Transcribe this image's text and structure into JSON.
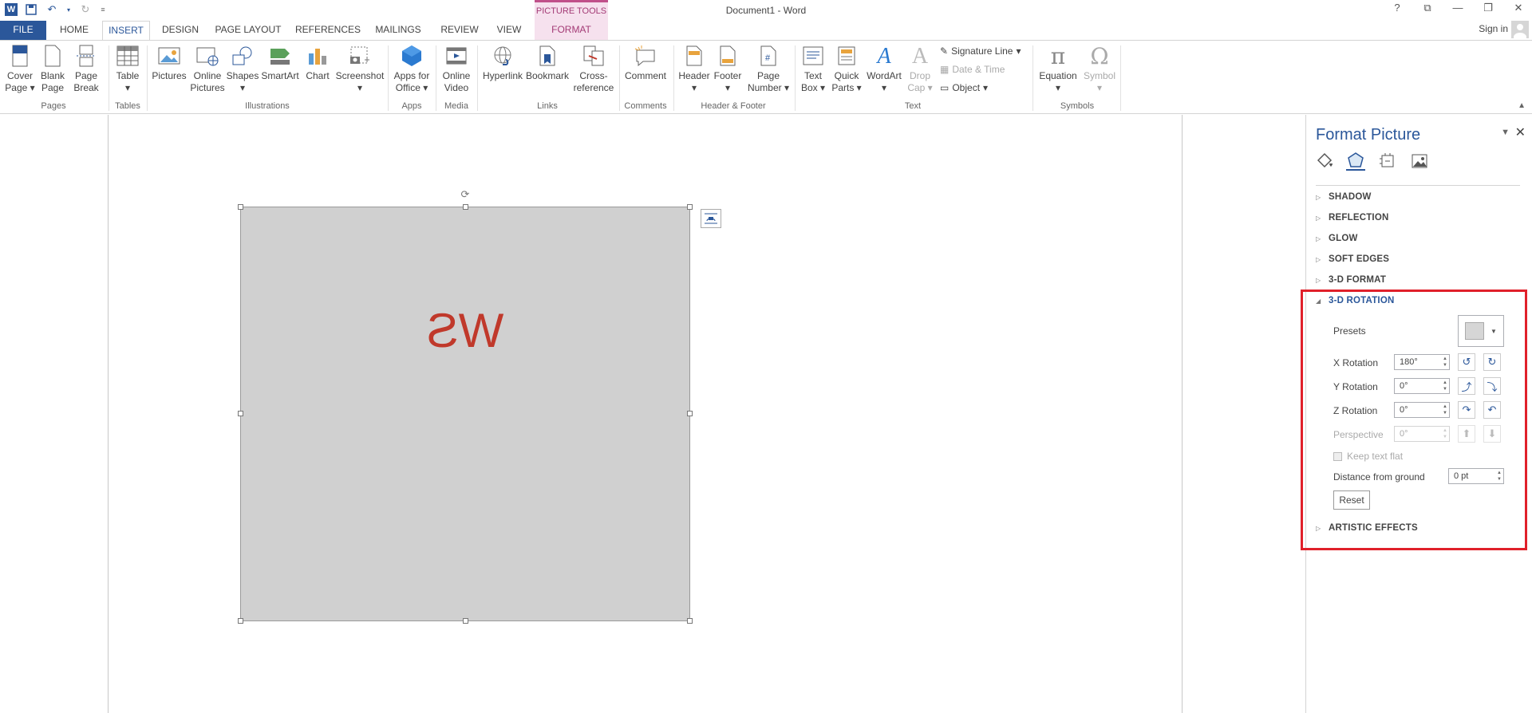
{
  "app": {
    "title": "Document1 - Word",
    "contextual_tab_group": "PICTURE TOOLS",
    "sign_in": "Sign in",
    "help": "?",
    "restore_label": "⧉",
    "minimize": "—",
    "maximize": "❐",
    "close": "✕"
  },
  "tabs": [
    "FILE",
    "HOME",
    "INSERT",
    "DESIGN",
    "PAGE LAYOUT",
    "REFERENCES",
    "MAILINGS",
    "REVIEW",
    "VIEW",
    "FORMAT"
  ],
  "active_tab": "INSERT",
  "ribbon": {
    "pages": {
      "label": "Pages",
      "cover_page": [
        "Cover",
        "Page"
      ],
      "blank_page": [
        "Blank",
        "Page"
      ],
      "page_break": [
        "Page",
        "Break"
      ]
    },
    "tables": {
      "label": "Tables",
      "table": "Table"
    },
    "illustrations": {
      "label": "Illustrations",
      "pictures": "Pictures",
      "online_pictures": [
        "Online",
        "Pictures"
      ],
      "shapes": "Shapes",
      "smartart": "SmartArt",
      "chart": "Chart",
      "screenshot": "Screenshot"
    },
    "apps": {
      "label": "Apps",
      "apps_for_office": [
        "Apps for",
        "Office"
      ]
    },
    "media": {
      "label": "Media",
      "online_video": [
        "Online",
        "Video"
      ]
    },
    "links": {
      "label": "Links",
      "hyperlink": "Hyperlink",
      "bookmark": "Bookmark",
      "cross_reference": [
        "Cross-",
        "reference"
      ]
    },
    "comments": {
      "label": "Comments",
      "comment": "Comment"
    },
    "header_footer": {
      "label": "Header & Footer",
      "header": "Header",
      "footer": "Footer",
      "page_number": [
        "Page",
        "Number"
      ]
    },
    "text": {
      "label": "Text",
      "text_box": [
        "Text",
        "Box"
      ],
      "quick_parts": [
        "Quick",
        "Parts"
      ],
      "wordart": "WordArt",
      "drop_cap": [
        "Drop",
        "Cap"
      ],
      "signature_line": "Signature Line",
      "date_time": "Date & Time",
      "object": "Object"
    },
    "symbols": {
      "label": "Symbols",
      "equation": "Equation",
      "symbol": "Symbol"
    }
  },
  "document": {
    "picture_text": "WS"
  },
  "pane": {
    "title": "Format Picture",
    "sections_collapsed_top": [
      "SHADOW",
      "REFLECTION",
      "GLOW",
      "SOFT EDGES",
      "3-D FORMAT"
    ],
    "expanded_section": "3-D ROTATION",
    "presets_label": "Presets",
    "x_rotation_label": "X Rotation",
    "x_rotation_value": "180°",
    "y_rotation_label": "Y Rotation",
    "y_rotation_value": "0°",
    "z_rotation_label": "Z Rotation",
    "z_rotation_value": "0°",
    "perspective_label": "Perspective",
    "perspective_value": "0°",
    "keep_text_flat": "Keep text flat",
    "distance_label": "Distance from ground",
    "distance_value": "0 pt",
    "reset": "Reset",
    "section_bottom": "ARTISTIC EFFECTS"
  },
  "colors": {
    "accent": "#2b579a",
    "picture_tools": "#a33a75",
    "highlight": "#e0202a",
    "picture_fill": "#d0d0d0",
    "picture_text": "#c0392b"
  }
}
